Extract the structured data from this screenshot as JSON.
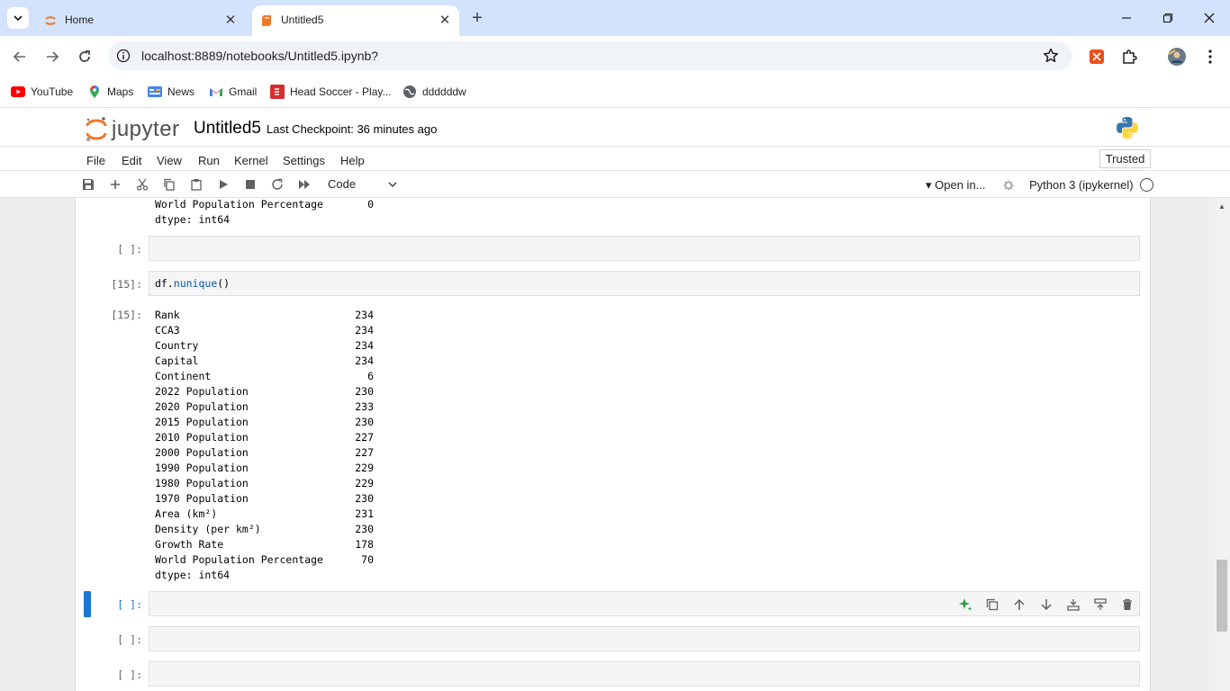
{
  "browser": {
    "tabs": [
      {
        "label": "Home",
        "active": false
      },
      {
        "label": "Untitled5",
        "active": true
      }
    ],
    "url": "localhost:8889/notebooks/Untitled5.ipynb?",
    "bookmarks": [
      {
        "label": "YouTube",
        "icon": "youtube-icon"
      },
      {
        "label": "Maps",
        "icon": "maps-icon"
      },
      {
        "label": "News",
        "icon": "news-icon"
      },
      {
        "label": "Gmail",
        "icon": "gmail-icon"
      },
      {
        "label": "Head Soccer - Play...",
        "icon": "head-soccer-icon"
      },
      {
        "label": "ddddddw",
        "icon": "globe-icon"
      }
    ]
  },
  "jupyter": {
    "logo_text": "jupyter",
    "notebook_title": "Untitled5",
    "checkpoint": "Last Checkpoint: 36 minutes ago",
    "menus": [
      "File",
      "Edit",
      "View",
      "Run",
      "Kernel",
      "Settings",
      "Help"
    ],
    "trusted": "Trusted",
    "cell_type": "Code",
    "open_in": "Open in...",
    "kernel_name": "Python 3 (ipykernel)"
  },
  "cells": {
    "prev_output_tail": [
      {
        "name": "World Population Percentage",
        "value": "0"
      },
      {
        "name": "dtype: int64",
        "value": ""
      }
    ],
    "empty_prompt": "[ ]:",
    "exec_prompt": "[15]:",
    "code_obj": "df.",
    "code_fn": "nunique",
    "code_tail": "()",
    "output_rows": [
      {
        "name": "Rank",
        "value": "234"
      },
      {
        "name": "CCA3",
        "value": "234"
      },
      {
        "name": "Country",
        "value": "234"
      },
      {
        "name": "Capital",
        "value": "234"
      },
      {
        "name": "Continent",
        "value": "6"
      },
      {
        "name": "2022 Population",
        "value": "230"
      },
      {
        "name": "2020 Population",
        "value": "233"
      },
      {
        "name": "2015 Population",
        "value": "230"
      },
      {
        "name": "2010 Population",
        "value": "227"
      },
      {
        "name": "2000 Population",
        "value": "227"
      },
      {
        "name": "1990 Population",
        "value": "229"
      },
      {
        "name": "1980 Population",
        "value": "229"
      },
      {
        "name": "1970 Population",
        "value": "230"
      },
      {
        "name": "Area (km²)",
        "value": "231"
      },
      {
        "name": "Density (per km²)",
        "value": "230"
      },
      {
        "name": "Growth Rate",
        "value": "178"
      },
      {
        "name": "World Population Percentage",
        "value": "70"
      },
      {
        "name": "dtype: int64",
        "value": ""
      }
    ]
  },
  "colors": {
    "tabbar": "#d3e3fd",
    "jupyter_orange": "#f37726",
    "active_cell": "#1976d2",
    "code_function": "#0055aa"
  }
}
